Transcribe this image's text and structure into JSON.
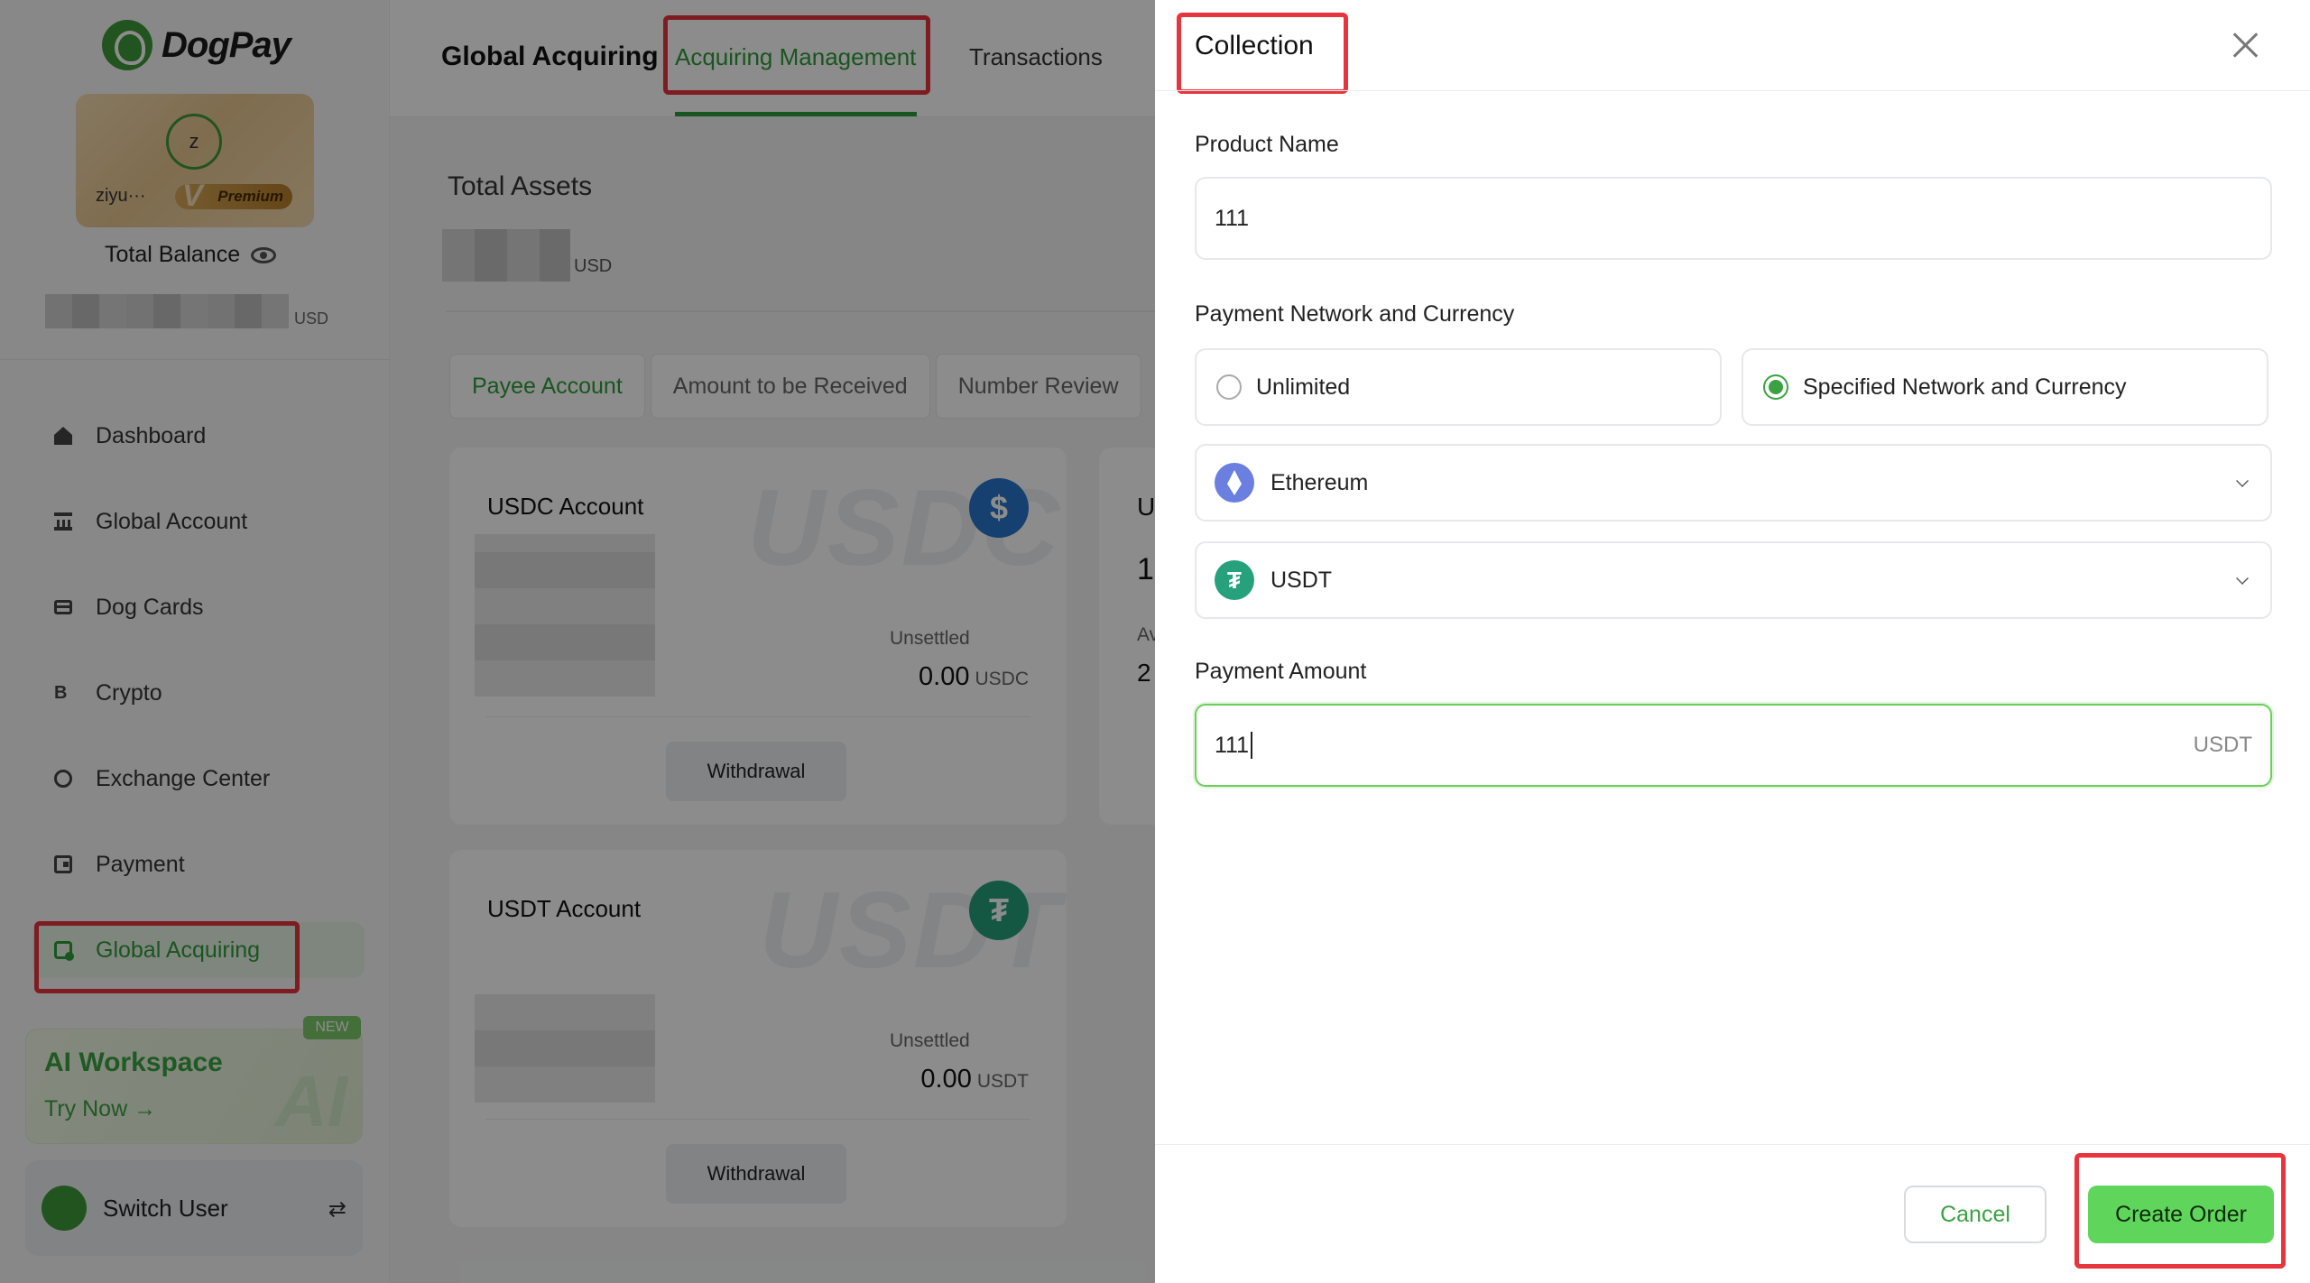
{
  "app": {
    "brand": "DogPay"
  },
  "sidebar": {
    "user_avatar_letter": "z",
    "user_name": "ziyu···",
    "premium_label": "Premium",
    "total_balance_label": "Total Balance",
    "balance_unit": "USD",
    "nav": [
      {
        "label": "Dashboard",
        "icon": "home-icon"
      },
      {
        "label": "Global Account",
        "icon": "bank-icon"
      },
      {
        "label": "Dog Cards",
        "icon": "card-icon"
      },
      {
        "label": "Crypto",
        "icon": "crypto-icon"
      },
      {
        "label": "Exchange Center",
        "icon": "exchange-icon"
      },
      {
        "label": "Payment",
        "icon": "wallet-icon"
      },
      {
        "label": "Global Acquiring",
        "icon": "acquiring-icon",
        "active": true
      }
    ],
    "ai_workspace": {
      "title": "AI Workspace",
      "cta": "Try Now →",
      "badge": "NEW"
    },
    "switch_user_label": "Switch User"
  },
  "header": {
    "title": "Global Acquiring",
    "tabs": [
      {
        "label": "Acquiring Management",
        "active": true
      },
      {
        "label": "Transactions",
        "active": false
      }
    ]
  },
  "main": {
    "total_assets_label": "Total Assets",
    "total_assets_unit": "USD",
    "subtabs": [
      {
        "label": "Payee Account",
        "active": true
      },
      {
        "label": "Amount to be Received",
        "active": false
      },
      {
        "label": "Number Review",
        "active": false
      }
    ],
    "accounts": [
      {
        "title": "USDC Account",
        "watermark": "USDC",
        "unsettled_label": "Unsettled",
        "unsettled_value": "0.00",
        "currency": "USDC",
        "withdraw_label": "Withdrawal"
      },
      {
        "title": "USDT Account",
        "watermark": "USDT",
        "unsettled_label": "Unsettled",
        "unsettled_value": "0.00",
        "currency": "USDT",
        "withdraw_label": "Withdrawal"
      }
    ],
    "partial_card": {
      "line1": "U",
      "line2": "1",
      "line3": "Av",
      "line4": "2"
    }
  },
  "drawer": {
    "title": "Collection",
    "product_name_label": "Product Name",
    "product_name_value": "111",
    "network_label": "Payment Network and Currency",
    "network_options": [
      {
        "label": "Unlimited",
        "selected": false
      },
      {
        "label": "Specified Network and Currency",
        "selected": true
      }
    ],
    "network_select": "Ethereum",
    "currency_select": "USDT",
    "amount_label": "Payment Amount",
    "amount_value": "111",
    "amount_suffix": "USDT",
    "cancel_label": "Cancel",
    "create_label": "Create Order"
  },
  "colors": {
    "brand_green": "#3aa243",
    "primary_button": "#5fd65b",
    "highlight_red": "#e8343d",
    "usdc_blue": "#2775ca",
    "usdt_green": "#26a17b",
    "eth_purple": "#6a7fe0"
  }
}
